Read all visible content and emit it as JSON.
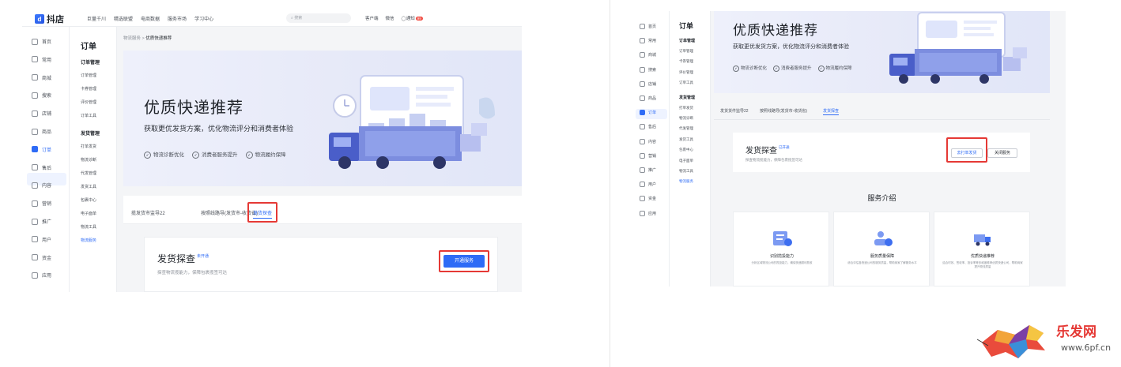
{
  "left": {
    "logo": "抖店",
    "topnav": [
      "巨量千川",
      "精选联盟",
      "电商数据",
      "服务市场",
      "学习中心"
    ],
    "search_placeholder": "搜索",
    "topright": [
      "客户端",
      "微信",
      "通知"
    ],
    "notify_count": "99",
    "iconbar": [
      "首页",
      "常用",
      "商城",
      "搜索",
      "店铺",
      "商品",
      "订单",
      "售后",
      "内容",
      "营销",
      "推广",
      "用户",
      "资金",
      "应用"
    ],
    "sub_title": "订单",
    "groups": [
      {
        "label": "订单管理",
        "items": [
          "订单管理",
          "卡券管理",
          "评价管理",
          "订单工具"
        ]
      },
      {
        "label": "发货管理",
        "items": [
          "打单发货",
          "物流诊断",
          "代发管理",
          "发货工具",
          "包裹中心",
          "电子面单",
          "物流工具",
          "物流服务"
        ]
      }
    ],
    "breadcrumb_parent": "物流服务",
    "breadcrumb_current": "优质快递推荐",
    "banner_title": "优质快递推荐",
    "banner_sub": "获取更优发货方案，优化物流评分和消费者体验",
    "banner_feats": [
      "物流诊断优化",
      "消费者服务提升",
      "物流履约保障"
    ],
    "tabs": [
      "揽发货市监导22",
      "按照线路导(发货市-收货省)",
      "发货探查"
    ],
    "card_title": "发货探查",
    "card_tag": "未开通",
    "card_desc": "探查物流揽能力，保障包裹揽签可达",
    "card_btn": "开通服务"
  },
  "right": {
    "iconbar": [
      "首页",
      "常用",
      "商城",
      "搜索",
      "店铺",
      "商品",
      "订单",
      "售后",
      "内容",
      "营销",
      "推广",
      "用户",
      "资金",
      "应用"
    ],
    "sub_title": "订单",
    "groups": [
      {
        "label": "订单管理",
        "items": [
          "订单管理",
          "卡券管理",
          "评价管理",
          "订单工具"
        ]
      },
      {
        "label": "发货管理",
        "items": [
          "打单发货",
          "物流诊断",
          "代发管理",
          "发货工具",
          "包裹中心",
          "电子面单",
          "物流工具",
          "物流服务"
        ]
      }
    ],
    "banner_title": "优质快递推荐",
    "banner_sub": "获取更优发货方案，优化物流评分和消费者体验",
    "banner_feats": [
      "物流诊断优化",
      "消费者服务提升",
      "物流履约保障"
    ],
    "tabs": [
      "发货货件监导22",
      "按照线路导(发货市-收货省)",
      "发货探查"
    ],
    "card_title": "发货探查",
    "card_tag": "已开通",
    "card_desc": "探查物流揽能力，保障包裹揽签可达",
    "btn_primary": "去打单发货",
    "btn_secondary": "关闭服务",
    "svc_title": "服务介绍",
    "services": [
      {
        "name": "识别揽投能力",
        "desc": "分析区域物流公司的揽投能力，确保快递顺利揽收"
      },
      {
        "name": "服务质量保障",
        "desc": "综合评估各快递公司的服务质量，帮助商家了解服务水平"
      },
      {
        "name": "优质快递推荐",
        "desc": "结合时效、签收率、投诉率等多维度推荐优质快递公司，帮助商家提升物流质量"
      }
    ]
  },
  "watermark": {
    "site": "乐发网",
    "url": "www.6pf.cn"
  },
  "colors": {
    "accent": "#2e6bf6",
    "highlight": "#e53935"
  }
}
